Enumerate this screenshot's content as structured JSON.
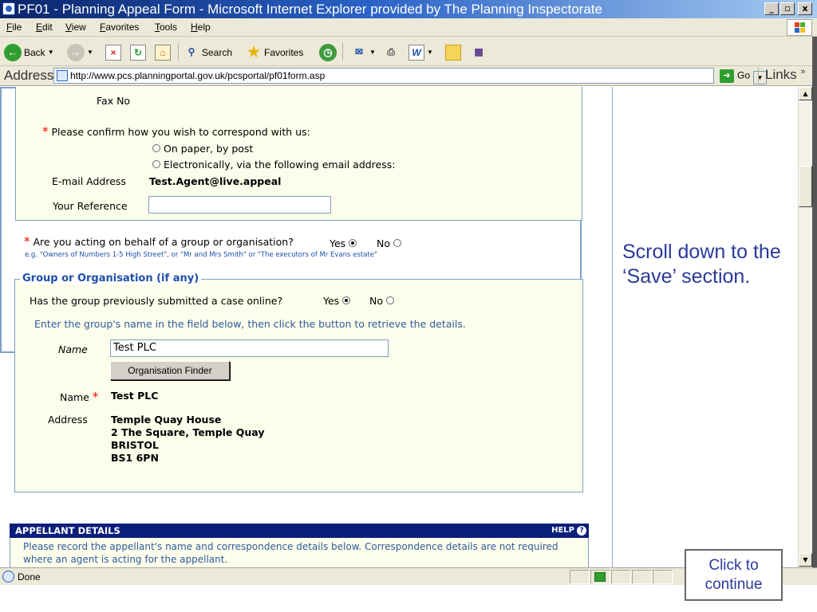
{
  "window": {
    "title": "PF01 - Planning Appeal Form - Microsoft Internet Explorer provided by The Planning Inspectorate",
    "minimize": "_",
    "maximize": "▫",
    "close": "x"
  },
  "menu": [
    "File",
    "Edit",
    "View",
    "Favorites",
    "Tools",
    "Help"
  ],
  "toolbar": {
    "back": "Back",
    "search": "Search",
    "favorites": "Favorites"
  },
  "address": {
    "label": "Address",
    "url": "http://www.pcs.planningportal.gov.uk/pcsportal/pf01form.asp",
    "go": "Go",
    "links": "Links"
  },
  "agent": {
    "fax_label": "Fax No",
    "correspond_question": "Please confirm how you wish to correspond with us:",
    "option_paper": "On paper, by post",
    "option_email": "Electronically, via the following email address:",
    "email_label": "E-mail Address",
    "email_value": "Test.Agent@live.appeal",
    "reference_label": "Your Reference",
    "reference_value": ""
  },
  "behalf": {
    "question": "Are you acting on behalf of a group or organisation?",
    "yes": "Yes",
    "no": "No",
    "example": "e.g. \"Owners of Numbers 1-5 High Street\", or \"Mr and Mrs Smith\" or \"The executors of Mr Evans estate\""
  },
  "group": {
    "legend": "Group or Organisation (if any)",
    "question": "Has the group previously submitted a case online?",
    "yes": "Yes",
    "no": "No",
    "instruction": "Enter the group's name in the field below, then click the button to retrieve the details.",
    "name_label": "Name",
    "name_value": "Test PLC",
    "finder_button": "Organisation Finder",
    "result_name_label": "Name",
    "result_name": "Test PLC",
    "address_label": "Address",
    "address_lines": [
      "Temple Quay House",
      "2 The Square, Temple Quay",
      "BRISTOL",
      "BS1 6PN"
    ]
  },
  "appellant": {
    "heading": "APPELLANT DETAILS",
    "help": "HELP",
    "text": "Please record the appellant's name and correspondence details below. Correspondence details are not required where an agent is acting for the appellant."
  },
  "instruction": "Scroll down to the ‘Save’ section.",
  "continue": "Click to continue",
  "status": {
    "text": "Done"
  },
  "colors": {
    "title_bar": "#0a246a",
    "accent_blue": "#2a3a9a",
    "section_header": "#0a1f7a",
    "required": "#e00000"
  }
}
